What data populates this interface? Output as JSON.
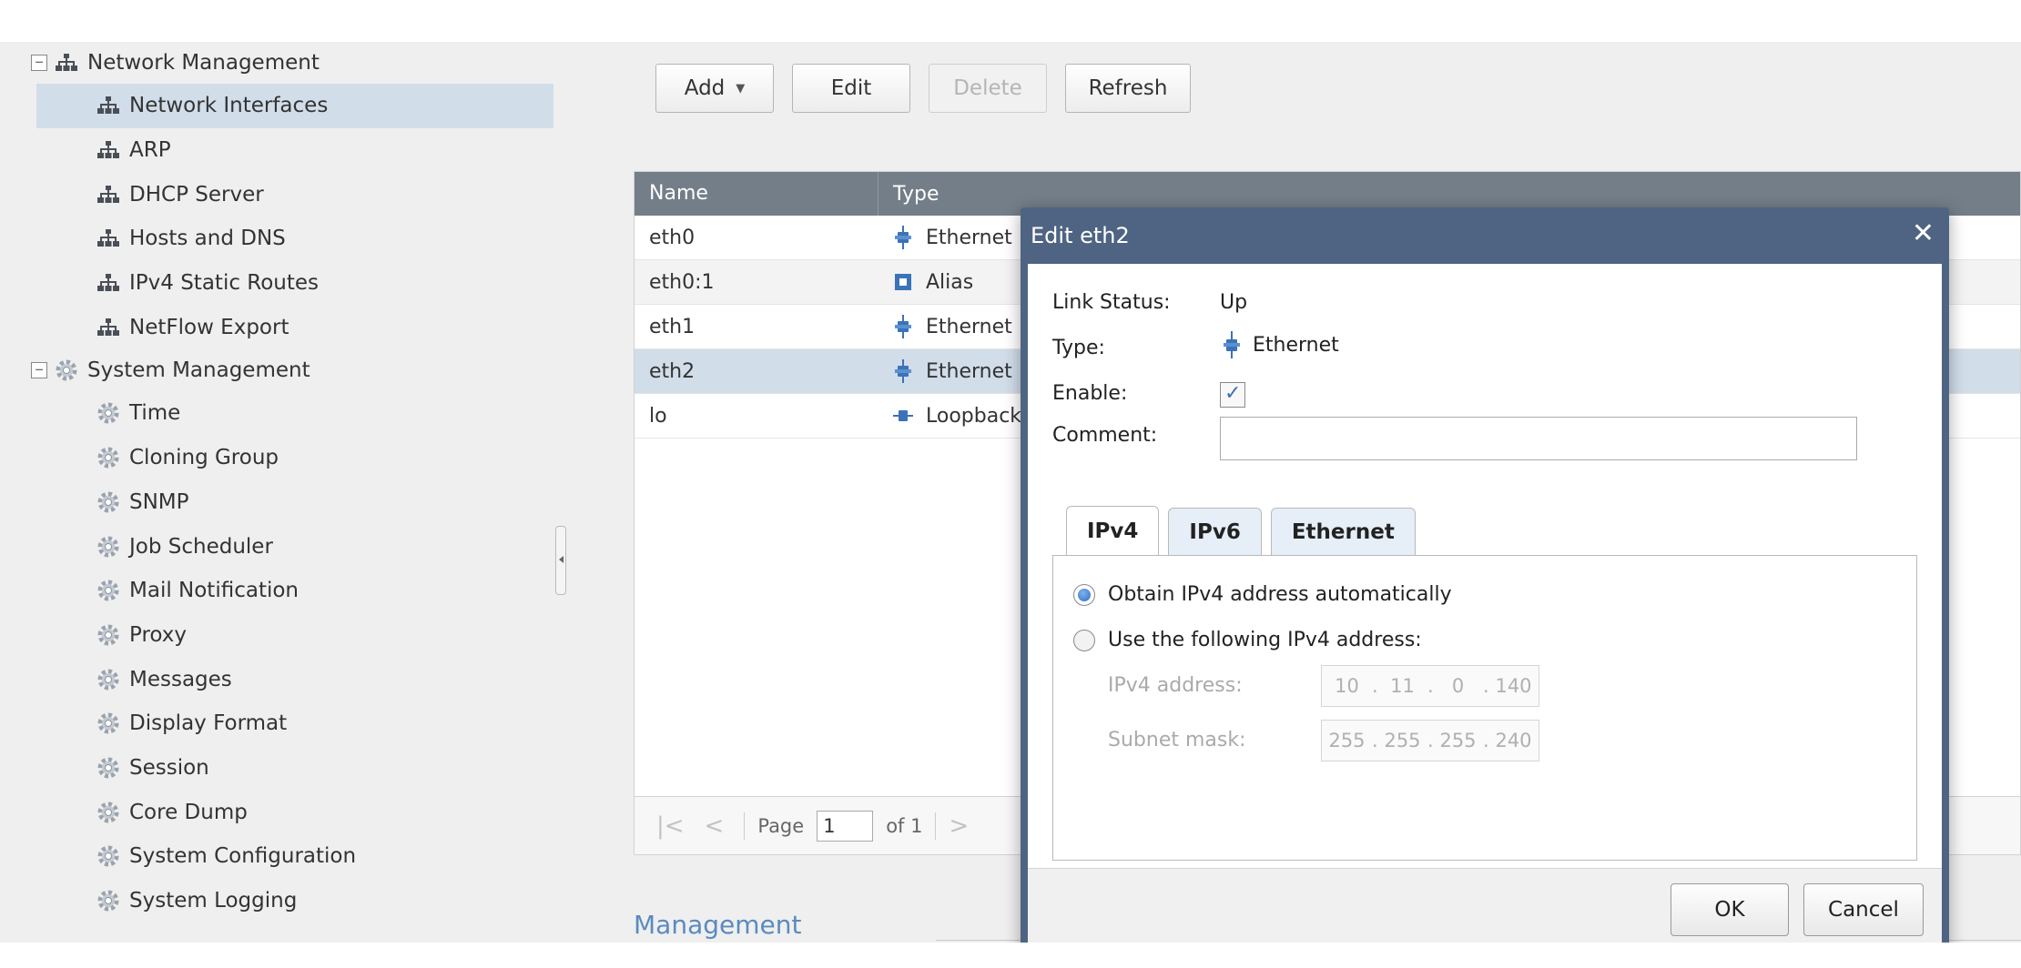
{
  "sidebar": {
    "network_management": {
      "label": "Network Management",
      "items": [
        {
          "label": "Network Interfaces"
        },
        {
          "label": "ARP"
        },
        {
          "label": "DHCP Server"
        },
        {
          "label": "Hosts and DNS"
        },
        {
          "label": "IPv4 Static Routes"
        },
        {
          "label": "NetFlow Export"
        }
      ]
    },
    "system_management": {
      "label": "System Management",
      "items": [
        {
          "label": "Time"
        },
        {
          "label": "Cloning Group"
        },
        {
          "label": "SNMP"
        },
        {
          "label": "Job Scheduler"
        },
        {
          "label": "Mail Notification"
        },
        {
          "label": "Proxy"
        },
        {
          "label": "Messages"
        },
        {
          "label": "Display Format"
        },
        {
          "label": "Session"
        },
        {
          "label": "Core Dump"
        },
        {
          "label": "System Configuration"
        },
        {
          "label": "System Logging"
        }
      ]
    },
    "toggle_symbol": "−"
  },
  "toolbar": {
    "add_label": "Add",
    "edit_label": "Edit",
    "delete_label": "Delete",
    "refresh_label": "Refresh"
  },
  "grid": {
    "columns": [
      "Name",
      "Type"
    ],
    "rows": [
      {
        "name": "eth0",
        "type": "Ethernet",
        "icon": "ethernet-icon"
      },
      {
        "name": "eth0:1",
        "type": "Alias",
        "icon": "alias-icon"
      },
      {
        "name": "eth1",
        "type": "Ethernet",
        "icon": "ethernet-icon"
      },
      {
        "name": "eth2",
        "type": "Ethernet",
        "icon": "ethernet-icon"
      },
      {
        "name": "lo",
        "type": "Loopback",
        "icon": "loopback-icon"
      }
    ],
    "pager": {
      "page_label": "Page",
      "current_page": "1",
      "of_label": "of 1"
    }
  },
  "section": {
    "management_interface": "Management Interface"
  },
  "dialog": {
    "title": "Edit eth2",
    "close_symbol": "✕",
    "link_status_label": "Link Status:",
    "link_status_value": "Up",
    "type_label": "Type:",
    "type_value": "Ethernet",
    "enable_label": "Enable:",
    "enable_checked": true,
    "checkbox_mark": "✓",
    "comment_label": "Comment:",
    "comment_value": "",
    "tabs": [
      {
        "label": "IPv4",
        "active": true
      },
      {
        "label": "IPv6",
        "active": false
      },
      {
        "label": "Ethernet",
        "active": false
      }
    ],
    "ipv4": {
      "obtain_auto_label": "Obtain IPv4 address automatically",
      "use_following_label": "Use the following IPv4 address:",
      "selected": "auto",
      "address_label": "IPv4 address:",
      "address": [
        "10",
        "11",
        "0",
        "140"
      ],
      "subnet_label": "Subnet mask:",
      "subnet": [
        "255",
        "255",
        "255",
        "240"
      ],
      "octet_separator": "."
    },
    "ok_label": "OK",
    "cancel_label": "Cancel"
  },
  "colors": {
    "dialog_frame": "#4e6482",
    "grid_header": "#737e88",
    "selected_row": "#d1dde9",
    "link_accent": "#5b8abf"
  }
}
